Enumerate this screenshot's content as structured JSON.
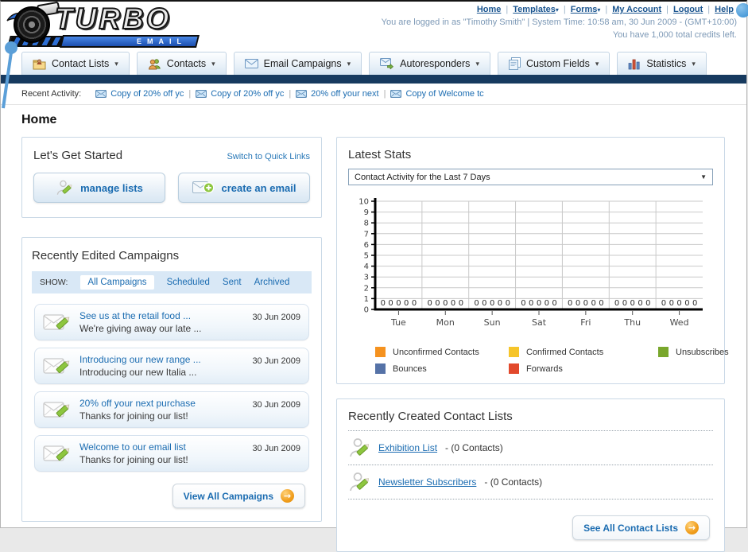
{
  "colors": {
    "link_blue": "#1b6cb1",
    "navy_bar": "#173a5f",
    "accent_orange": "#f09d1c",
    "panel_border": "#c9d8e6"
  },
  "header": {
    "logo_title": "TURBO",
    "logo_subtitle": "EMAIL",
    "nav": [
      {
        "label": "Home",
        "dropdown": false
      },
      {
        "label": "Templates",
        "dropdown": true
      },
      {
        "label": "Forms",
        "dropdown": true
      },
      {
        "label": "My Account",
        "dropdown": false
      },
      {
        "label": "Logout",
        "dropdown": false
      },
      {
        "label": "Help",
        "dropdown": false
      }
    ],
    "login_info": "You are logged in as \"Timothy Smith\" | System Time: 10:58 am, 30 Jun 2009 - (GMT+10:00)",
    "credits_info": "You have 1,000 total credits left."
  },
  "tabs": [
    {
      "label": "Contact Lists",
      "icon": "contact-lists-icon"
    },
    {
      "label": "Contacts",
      "icon": "contacts-icon"
    },
    {
      "label": "Email Campaigns",
      "icon": "envelope-icon"
    },
    {
      "label": "Autoresponders",
      "icon": "autoresponder-icon"
    },
    {
      "label": "Custom Fields",
      "icon": "custom-fields-icon"
    },
    {
      "label": "Statistics",
      "icon": "statistics-icon"
    }
  ],
  "recent_activity": {
    "label": "Recent Activity:",
    "items": [
      "Copy of 20% off yc",
      "Copy of 20% off yc",
      "20% off your next",
      "Copy of Welcome tc"
    ]
  },
  "page_title": "Home",
  "get_started": {
    "title": "Let's Get Started",
    "switch_link": "Switch to Quick Links",
    "manage_lists_label": "manage lists",
    "create_email_label": "create an email"
  },
  "campaigns": {
    "title": "Recently Edited Campaigns",
    "show_label": "SHOW:",
    "filters": [
      {
        "label": "All Campaigns",
        "active": true
      },
      {
        "label": "Scheduled",
        "active": false
      },
      {
        "label": "Sent",
        "active": false
      },
      {
        "label": "Archived",
        "active": false
      }
    ],
    "items": [
      {
        "title": "See us at the retail food ...",
        "subtitle": "We're giving away our late ...",
        "date": "30 Jun 2009"
      },
      {
        "title": "Introducing our new range ...",
        "subtitle": "Introducing our new Italia ...",
        "date": "30 Jun 2009"
      },
      {
        "title": "20% off your next purchase",
        "subtitle": "Thanks for joining our list!",
        "date": "30 Jun 2009"
      },
      {
        "title": "Welcome to our email list",
        "subtitle": "Thanks for joining our list!",
        "date": "30 Jun 2009"
      }
    ],
    "view_all_label": "View All Campaigns"
  },
  "latest_stats": {
    "title": "Latest Stats",
    "dropdown_value": "Contact Activity for the Last 7 Days"
  },
  "chart_data": {
    "type": "bar",
    "title": "Contact Activity for the Last 7 Days",
    "categories": [
      "Tue",
      "Mon",
      "Sun",
      "Sat",
      "Fri",
      "Thu",
      "Wed"
    ],
    "series": [
      {
        "name": "Unconfirmed Contacts",
        "color": "#f5921f",
        "values": [
          0,
          0,
          0,
          0,
          0,
          0,
          0
        ]
      },
      {
        "name": "Confirmed Contacts",
        "color": "#f6c52a",
        "values": [
          0,
          0,
          0,
          0,
          0,
          0,
          0
        ]
      },
      {
        "name": "Unsubscribes",
        "color": "#79a72c",
        "values": [
          0,
          0,
          0,
          0,
          0,
          0,
          0
        ]
      },
      {
        "name": "Bounces",
        "color": "#5572a7",
        "values": [
          0,
          0,
          0,
          0,
          0,
          0,
          0
        ]
      },
      {
        "name": "Forwards",
        "color": "#e2492c",
        "values": [
          0,
          0,
          0,
          0,
          0,
          0,
          0
        ]
      }
    ],
    "ylim": [
      0,
      10
    ],
    "yticks": [
      0,
      1,
      2,
      3,
      4,
      5,
      6,
      7,
      8,
      9,
      10
    ],
    "grid": true,
    "legend_position": "bottom"
  },
  "contact_lists": {
    "title": "Recently Created Contact Lists",
    "items": [
      {
        "name": "Exhibition List",
        "detail": "- (0 Contacts)"
      },
      {
        "name": "Newsletter Subscribers",
        "detail": "- (0 Contacts)"
      }
    ],
    "see_all_label": "See All Contact Lists"
  }
}
